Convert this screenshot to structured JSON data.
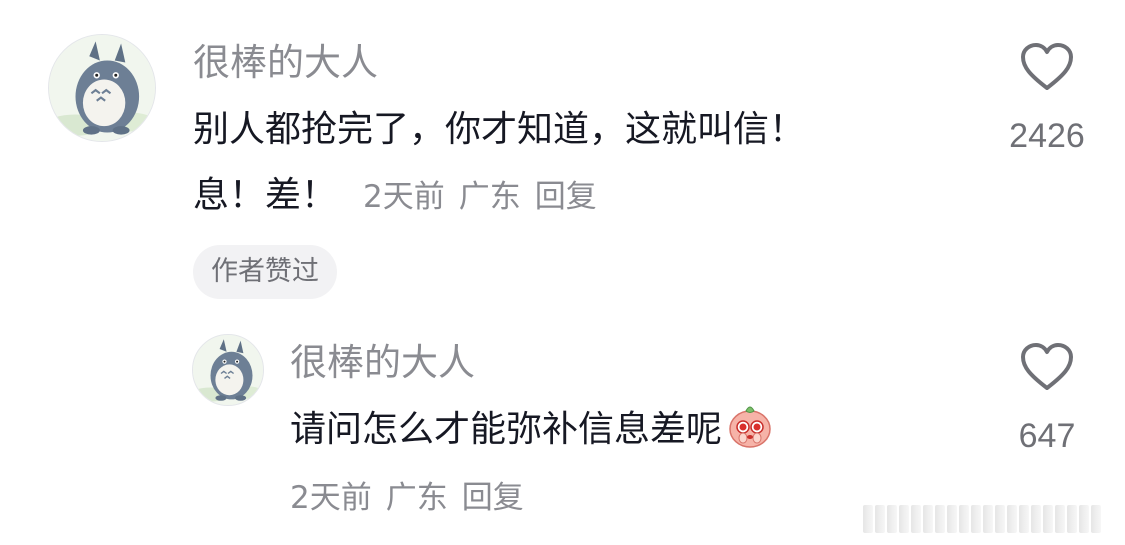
{
  "comments": [
    {
      "username": "很棒的大人",
      "text_line1": "别人都抢完了，你才知道，这就叫信！",
      "text_line2": "息！差！",
      "time": "2天前",
      "location": "广东",
      "reply": "回复",
      "badge": "作者赞过",
      "likes": "2426"
    },
    {
      "username": "很棒的大人",
      "text": "请问怎么才能弥补信息差呢",
      "emoji": "pleading-face-emoji",
      "time": "2天前",
      "location": "广东",
      "reply": "回复",
      "likes": "647"
    }
  ],
  "icons": {
    "like": "heart-outline-icon",
    "avatar": "totoro-avatar"
  },
  "colors": {
    "primary_text": "#161823",
    "secondary_text": "#8a8b91",
    "badge_bg": "#f2f2f4"
  }
}
